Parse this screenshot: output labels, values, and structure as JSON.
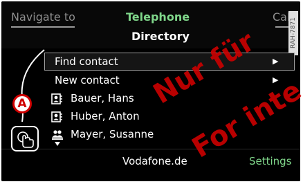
{
  "header": {
    "tabs": [
      {
        "label": "Navigate to",
        "active": false
      },
      {
        "label": "Telephone",
        "active": true
      },
      {
        "label": "Call",
        "active": false
      }
    ],
    "title": "Directory",
    "side_code": "RAH-7871"
  },
  "menu": {
    "items": [
      {
        "label": "Find contact",
        "arrow": "▶",
        "selected": true
      },
      {
        "label": "New contact",
        "arrow": "▶",
        "selected": false
      }
    ]
  },
  "contacts": [
    {
      "name": "Bauer, Hans",
      "icon": "person-card-icon"
    },
    {
      "name": "Huber, Anton",
      "icon": "person-card-icon"
    },
    {
      "name": "Mayer, Susanne",
      "icon": "two-persons-icon"
    }
  ],
  "footer": {
    "network": "Vodafone.de",
    "settings_label": "Settings"
  },
  "annotation": {
    "marker_label": "A"
  },
  "watermark": {
    "line1": "Nur für",
    "line2": "For inte"
  },
  "colors": {
    "accent_green": "#7fd68a",
    "background": "#000000",
    "watermark_red": "#d00000"
  }
}
